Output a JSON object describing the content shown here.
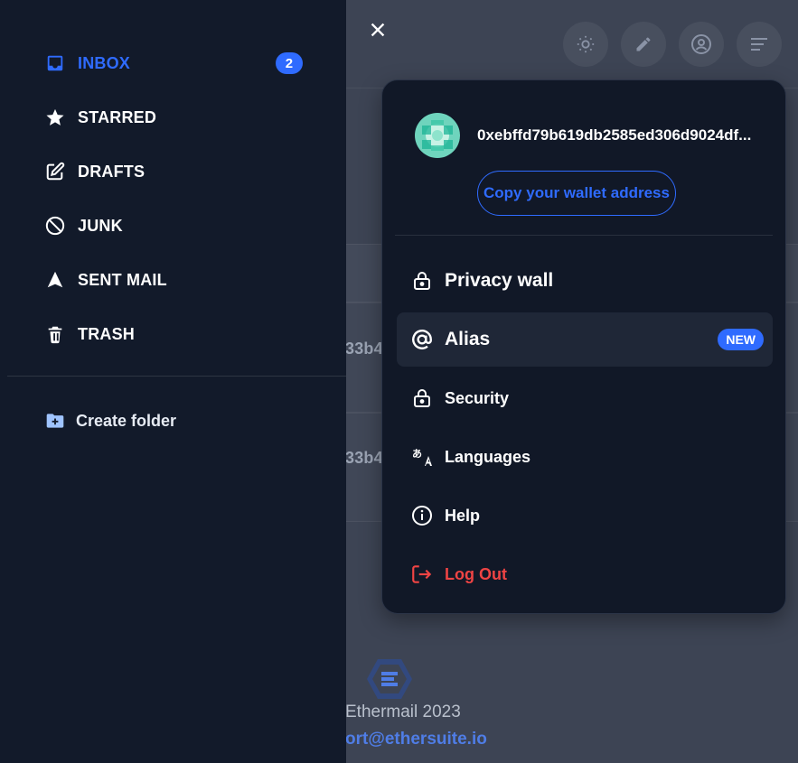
{
  "sidebar": {
    "items": [
      {
        "label": "INBOX",
        "badge": "2",
        "icon": "inbox-icon",
        "active": true
      },
      {
        "label": "STARRED",
        "icon": "star-icon"
      },
      {
        "label": "DRAFTS",
        "icon": "edit-icon"
      },
      {
        "label": "JUNK",
        "icon": "block-icon"
      },
      {
        "label": "SENT MAIL",
        "icon": "send-icon"
      },
      {
        "label": "TRASH",
        "icon": "trash-icon"
      }
    ],
    "create_folder_label": "Create folder"
  },
  "menu": {
    "address": "0xebffd79b619db2585ed306d9024df...",
    "copy_label": "Copy your wallet address",
    "items": [
      {
        "label": "Privacy wall",
        "icon": "lock-icon"
      },
      {
        "label": "Alias",
        "icon": "at-icon",
        "badge": "NEW"
      },
      {
        "label": "Security",
        "icon": "lock-icon"
      },
      {
        "label": "Languages",
        "icon": "translate-icon"
      },
      {
        "label": "Help",
        "icon": "info-icon"
      },
      {
        "label": "Log Out",
        "icon": "logout-icon"
      }
    ]
  },
  "background": {
    "row_fragment_1": "33b4",
    "row_fragment_2": "33b4",
    "footer_text": "Ethermail 2023",
    "footer_link": "ort@ethersuite.io"
  },
  "colors": {
    "accent": "#2f6bff",
    "logout": "#ef4444",
    "sidebar_bg": "#121a2a",
    "menu_bg": "#111827"
  }
}
